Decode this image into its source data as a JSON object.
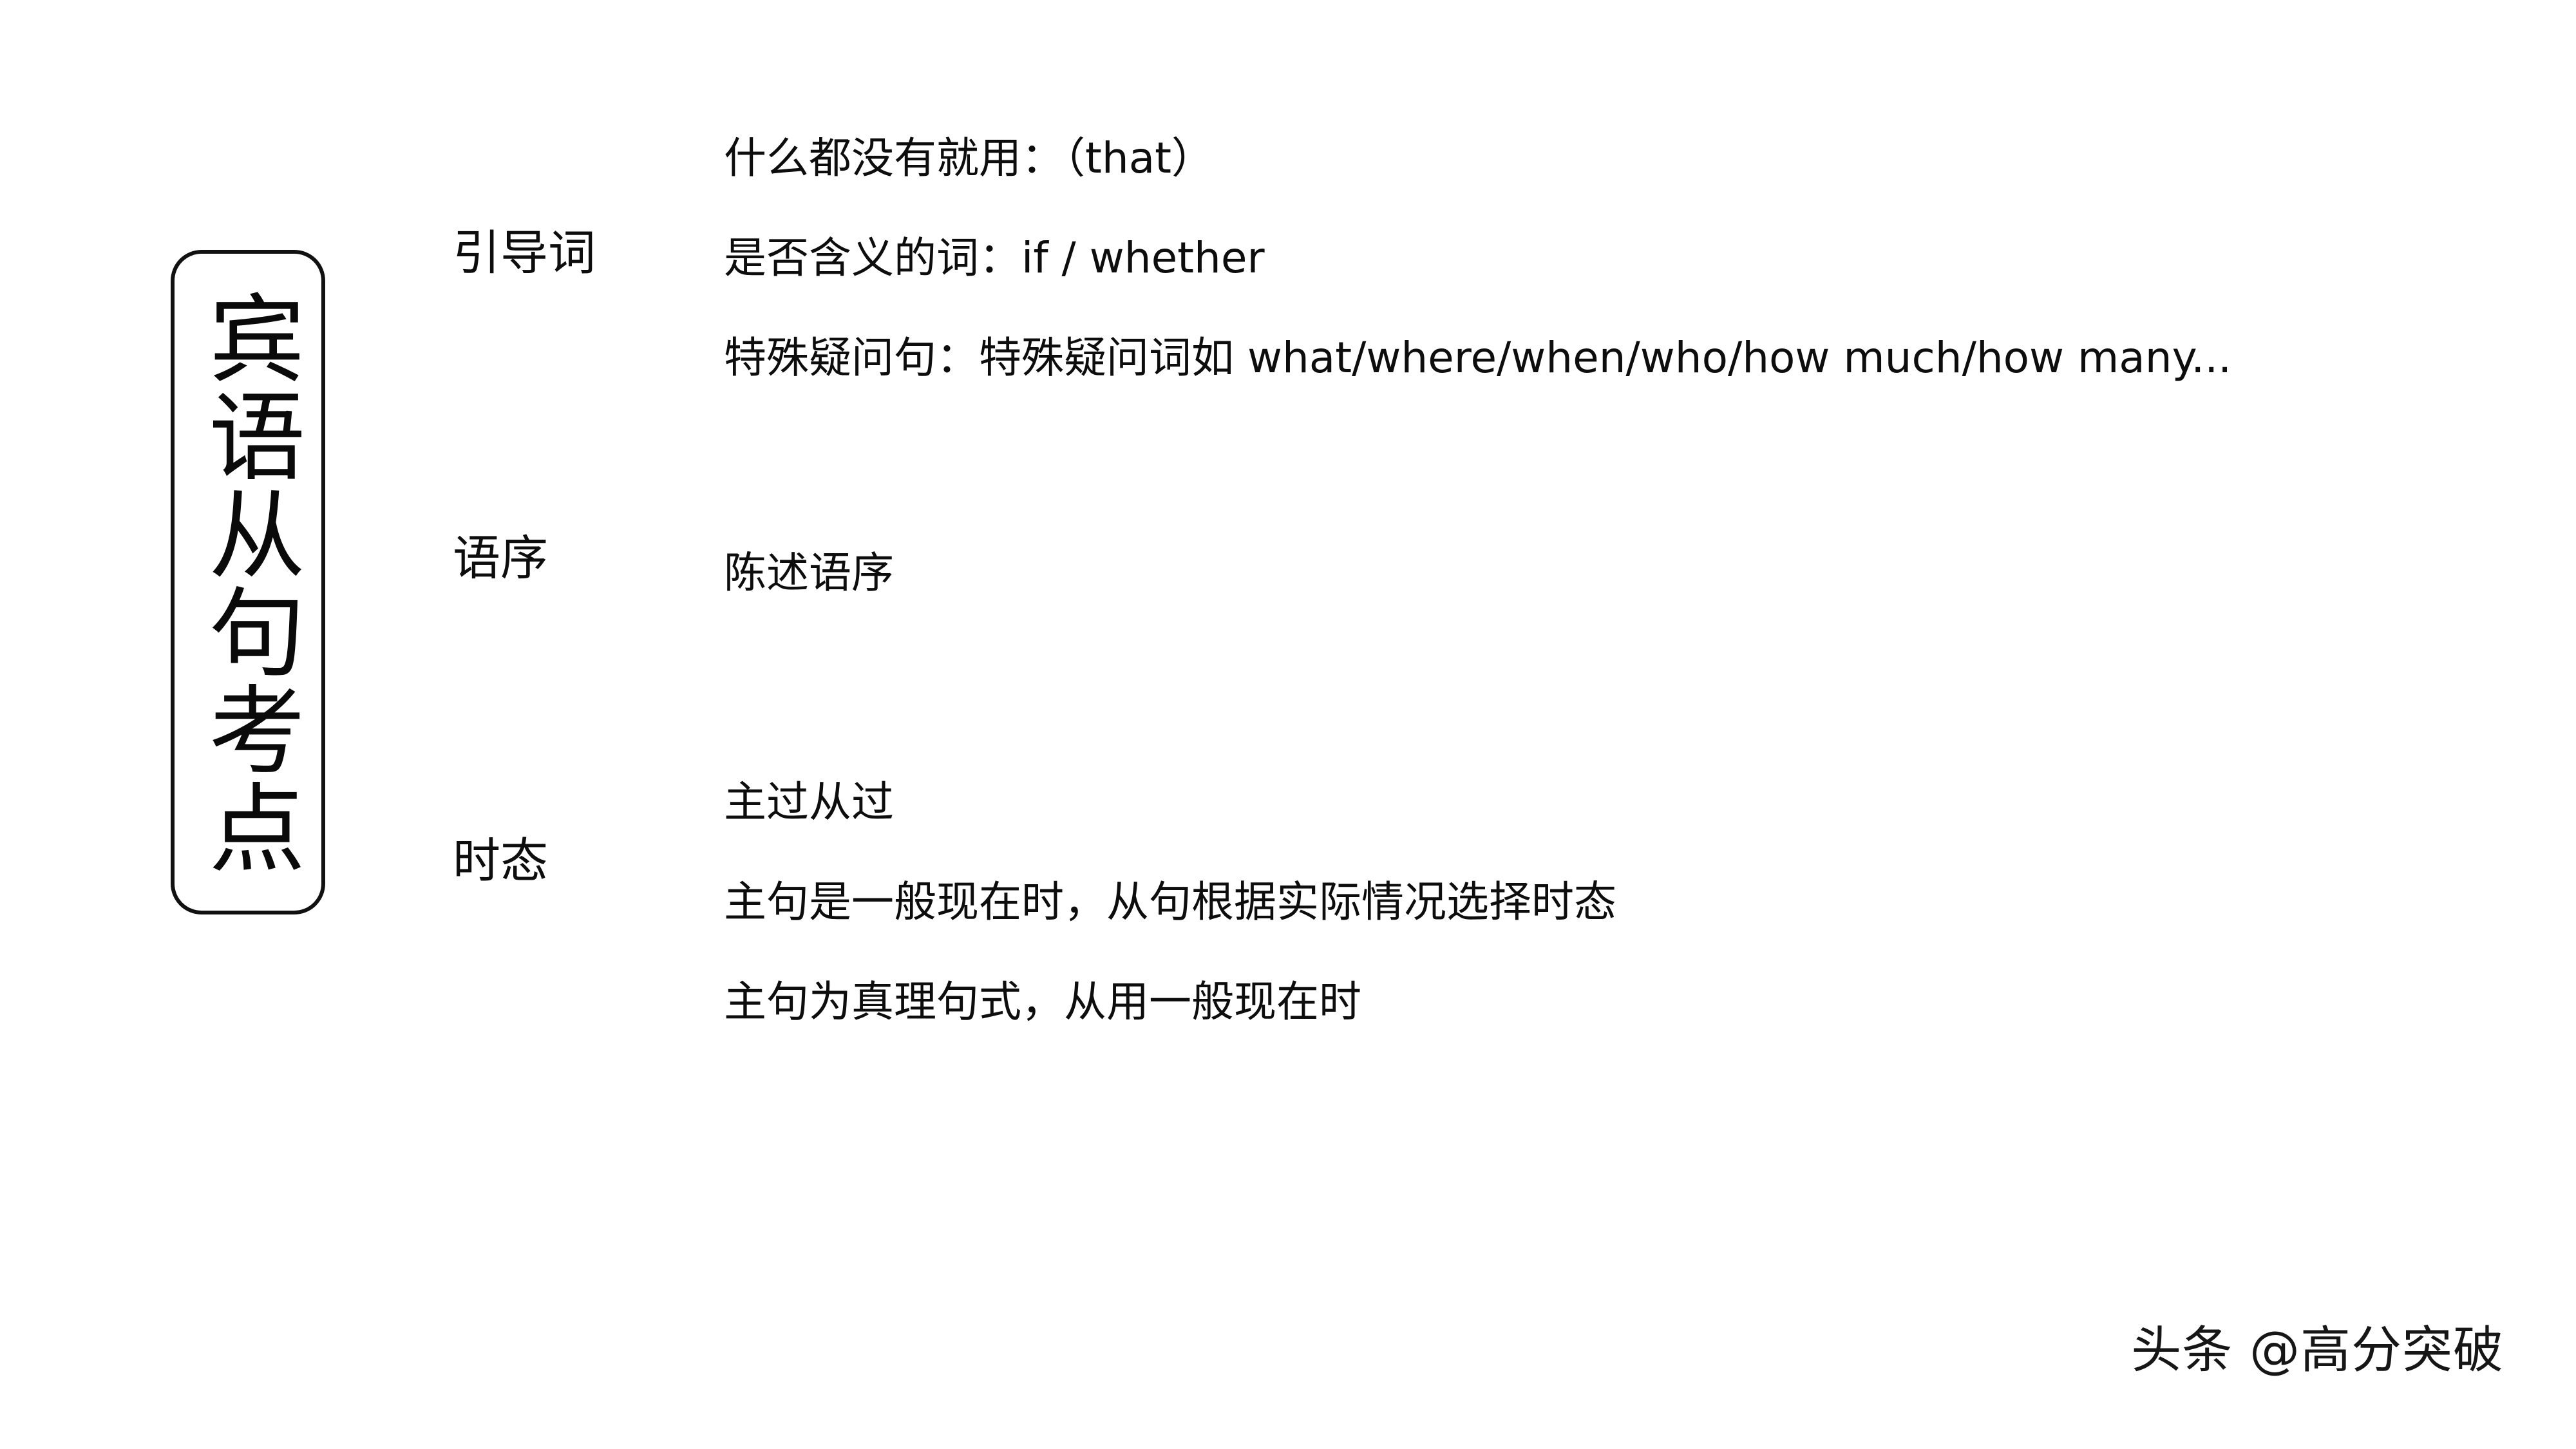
{
  "title_badge": {
    "text": "宾语从句考点"
  },
  "sections": [
    {
      "label": "引导词",
      "lines": [
        "什么都没有就用：（that）",
        "是否含义的词：if / whether",
        "特殊疑问句：特殊疑问词如 what/where/when/who/how much/how many..."
      ]
    },
    {
      "label": "语序",
      "lines": [
        "陈述语序"
      ]
    },
    {
      "label": "时态",
      "lines": [
        "主过从过",
        "主句是一般现在时，从句根据实际情况选择时态",
        "主句为真理句式，从用一般现在时"
      ]
    }
  ],
  "watermark": {
    "text": "头条 @高分突破"
  },
  "colors": {
    "background": "#ffffff",
    "text": "#0d0d0d",
    "border": "#111111"
  }
}
